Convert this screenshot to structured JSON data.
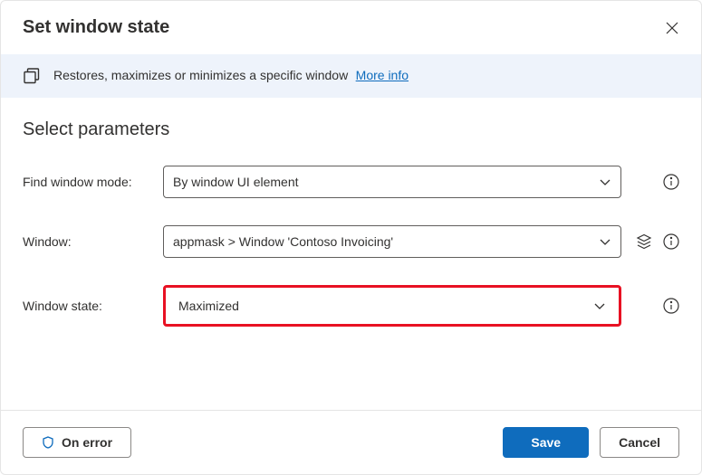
{
  "header": {
    "title": "Set window state"
  },
  "banner": {
    "text": "Restores, maximizes or minimizes a specific window",
    "link": "More info"
  },
  "section": {
    "title": "Select parameters"
  },
  "fields": {
    "find_mode": {
      "label": "Find window mode:",
      "value": "By window UI element"
    },
    "window": {
      "label": "Window:",
      "value": "appmask > Window 'Contoso Invoicing'"
    },
    "state": {
      "label": "Window state:",
      "value": "Maximized"
    }
  },
  "footer": {
    "on_error": "On error",
    "save": "Save",
    "cancel": "Cancel"
  }
}
